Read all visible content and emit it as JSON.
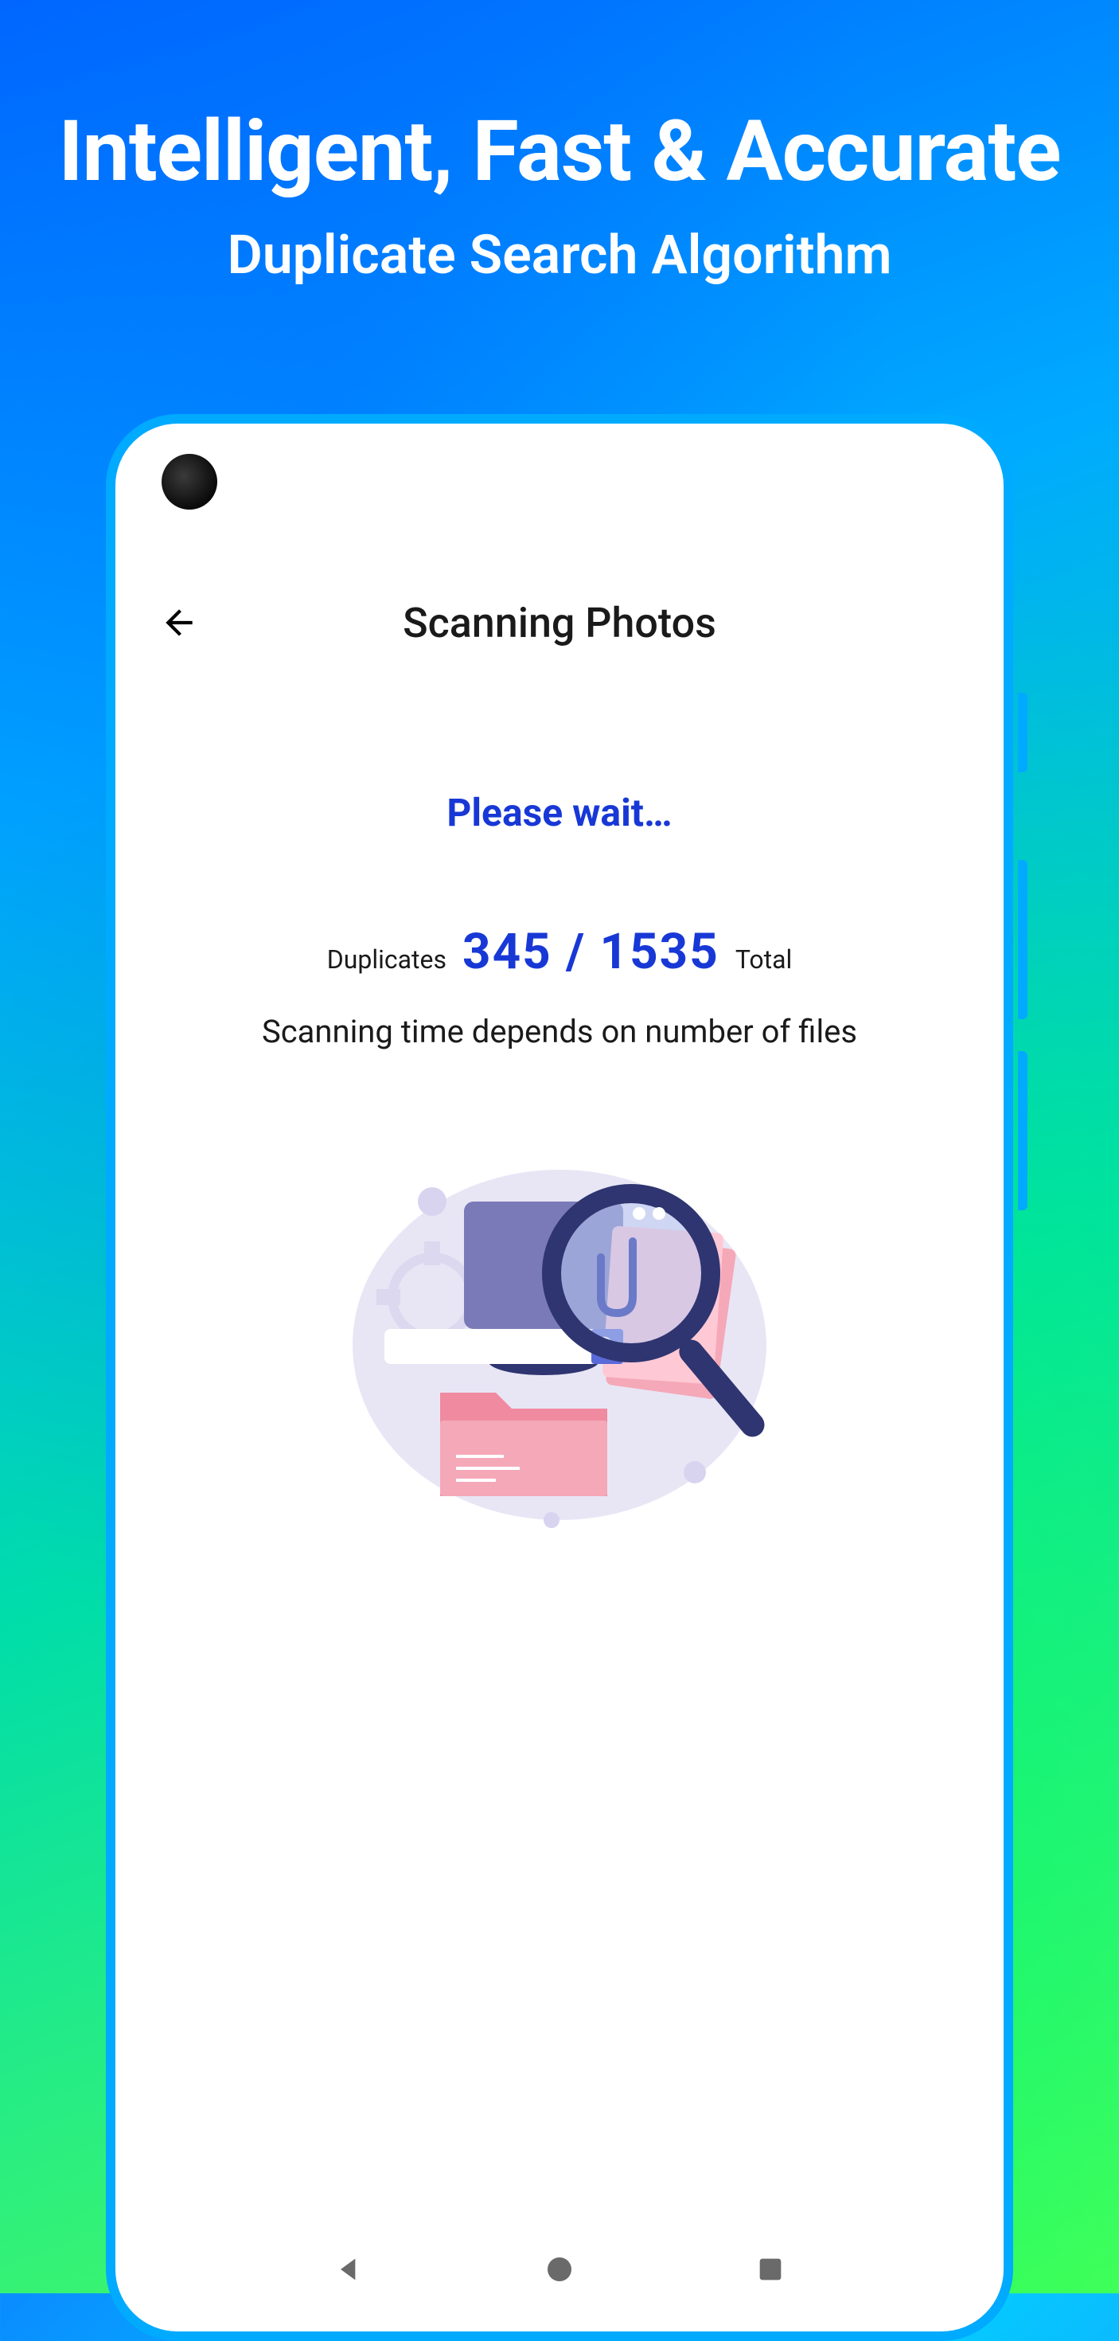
{
  "promo": {
    "title": "Intelligent, Fast & Accurate",
    "subtitle": "Duplicate Search Algorithm"
  },
  "app": {
    "header_title": "Scanning Photos",
    "wait_label": "Please wait…",
    "duplicates_label": "Duplicates",
    "total_label": "Total",
    "progress": "345  /  1535",
    "info": "Scanning time depends on number of files"
  }
}
